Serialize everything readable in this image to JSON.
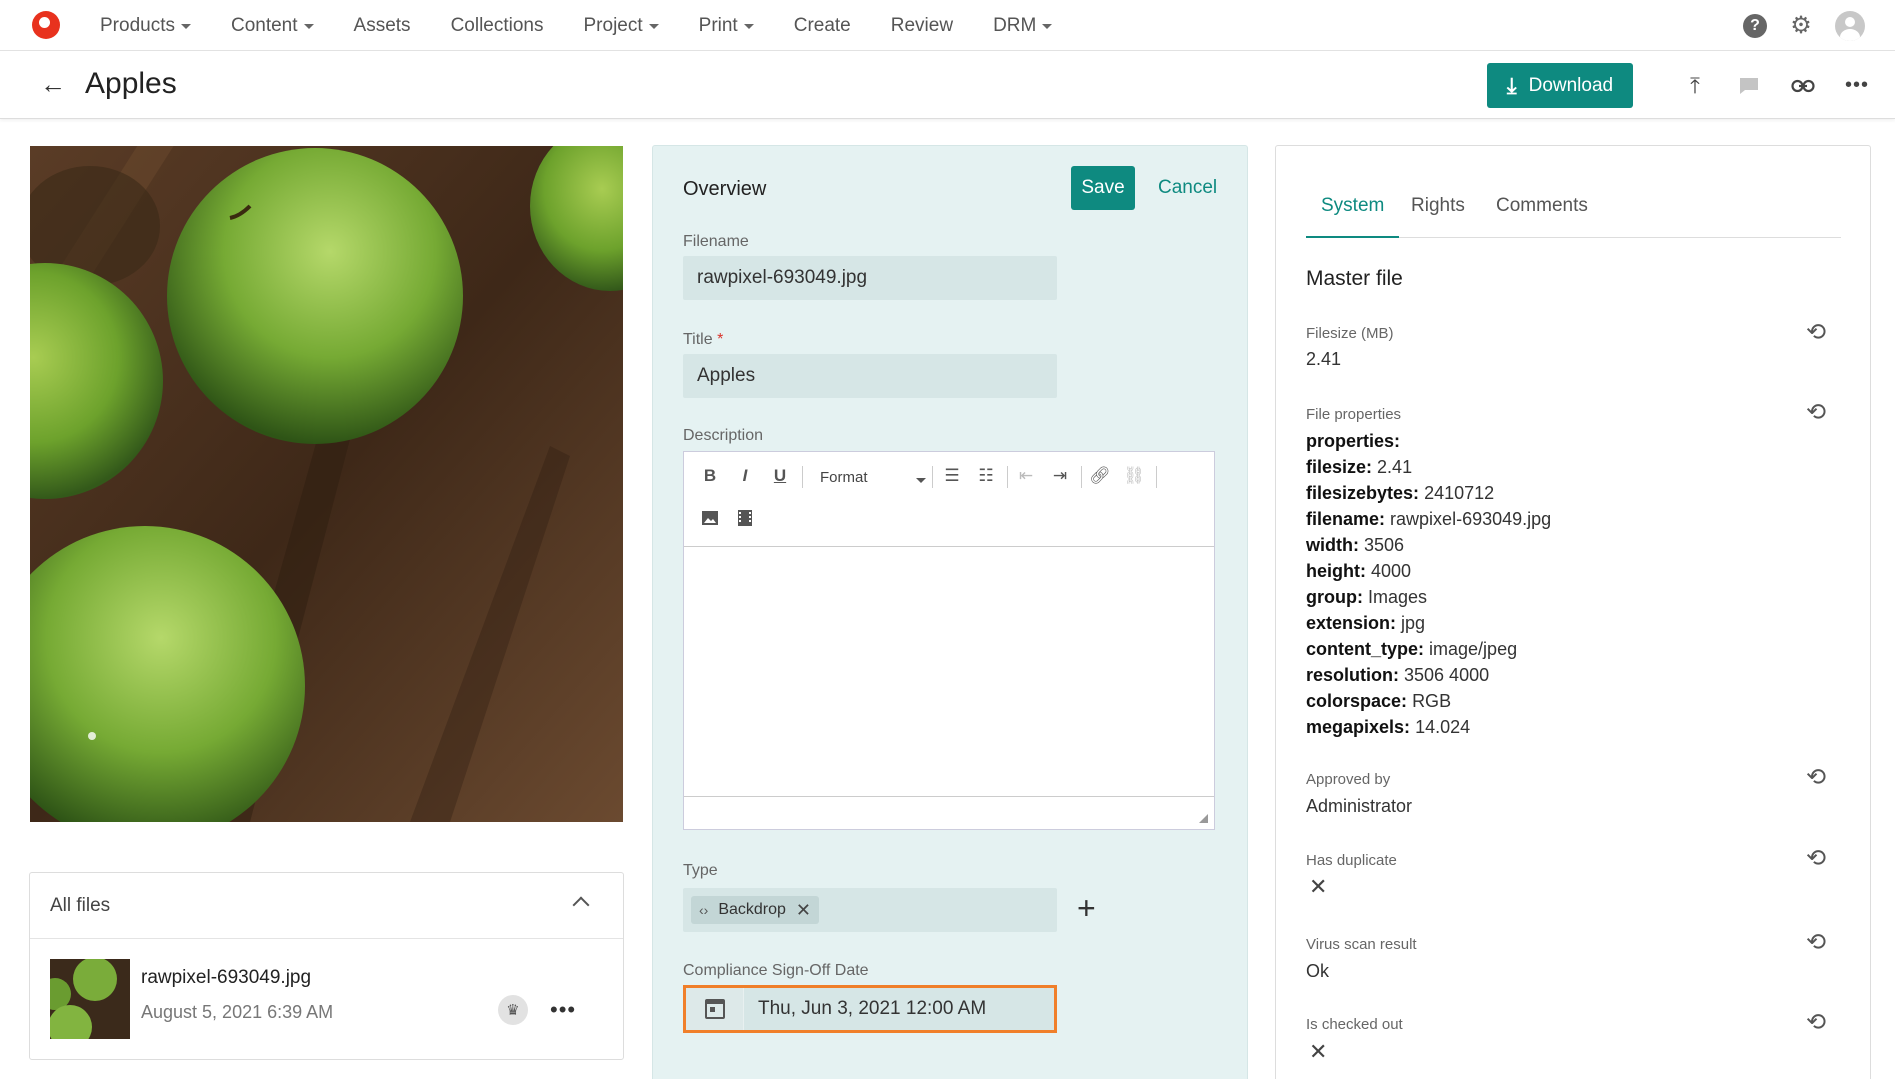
{
  "nav": {
    "items": [
      {
        "label": "Products",
        "dropdown": true
      },
      {
        "label": "Content",
        "dropdown": true
      },
      {
        "label": "Assets",
        "dropdown": false
      },
      {
        "label": "Collections",
        "dropdown": false
      },
      {
        "label": "Project",
        "dropdown": true
      },
      {
        "label": "Print",
        "dropdown": true
      },
      {
        "label": "Create",
        "dropdown": false
      },
      {
        "label": "Review",
        "dropdown": false
      },
      {
        "label": "DRM",
        "dropdown": true
      }
    ],
    "help_glyph": "?",
    "icons": [
      "help-icon",
      "gear-icon",
      "avatar-icon"
    ]
  },
  "header": {
    "title": "Apples",
    "download_label": "Download"
  },
  "files": {
    "heading": "All files",
    "items": [
      {
        "name": "rawpixel-693049.jpg",
        "date": "August 5, 2021 6:39 AM"
      }
    ]
  },
  "overview": {
    "title": "Overview",
    "save_label": "Save",
    "cancel_label": "Cancel",
    "filename_label": "Filename",
    "filename_value": "rawpixel-693049.jpg",
    "title_label": "Title",
    "title_value": "Apples",
    "description_label": "Description",
    "format_label": "Format",
    "type_label": "Type",
    "type_chip": "Backdrop",
    "date_label": "Compliance Sign-Off Date",
    "date_value": "Thu, Jun 3, 2021 12:00 AM"
  },
  "system": {
    "tabs": [
      "System",
      "Rights",
      "Comments"
    ],
    "active_tab": "System",
    "section_title": "Master file",
    "filesize_label": "Filesize (MB)",
    "filesize_value": "2.41",
    "file_props_label": "File properties",
    "file_props": [
      {
        "key": "properties:",
        "value": ""
      },
      {
        "key": "filesize:",
        "value": "2.41"
      },
      {
        "key": "filesizebytes:",
        "value": "2410712"
      },
      {
        "key": "filename:",
        "value": "rawpixel-693049.jpg"
      },
      {
        "key": "width:",
        "value": "3506"
      },
      {
        "key": "height:",
        "value": "4000"
      },
      {
        "key": "group:",
        "value": "Images"
      },
      {
        "key": "extension:",
        "value": "jpg"
      },
      {
        "key": "content_type:",
        "value": "image/jpeg"
      },
      {
        "key": "resolution:",
        "value": "3506 4000"
      },
      {
        "key": "colorspace:",
        "value": "RGB"
      },
      {
        "key": "megapixels:",
        "value": "14.024"
      }
    ],
    "approved_label": "Approved by",
    "approved_value": "Administrator",
    "duplicate_label": "Has duplicate",
    "virus_label": "Virus scan result",
    "virus_value": "Ok",
    "checked_out_label": "Is checked out"
  },
  "colors": {
    "accent": "#0e8a80",
    "overview_bg": "#e5f2f2",
    "focus_border": "#f07f2a",
    "logo": "#e8321e"
  }
}
